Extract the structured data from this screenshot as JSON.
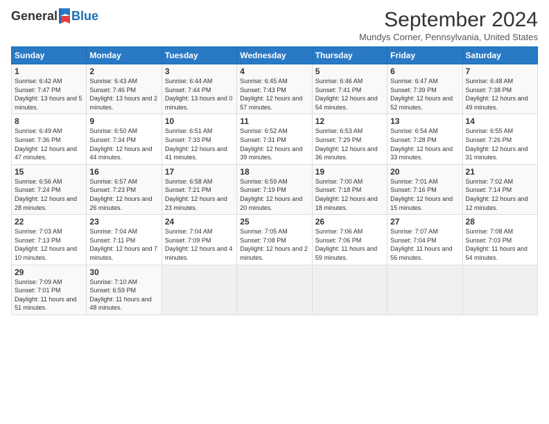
{
  "logo": {
    "general": "General",
    "blue": "Blue"
  },
  "title": "September 2024",
  "location": "Mundys Corner, Pennsylvania, United States",
  "days_of_week": [
    "Sunday",
    "Monday",
    "Tuesday",
    "Wednesday",
    "Thursday",
    "Friday",
    "Saturday"
  ],
  "weeks": [
    [
      {
        "day": "1",
        "sunrise": "6:42 AM",
        "sunset": "7:47 PM",
        "daylight": "13 hours and 5 minutes."
      },
      {
        "day": "2",
        "sunrise": "6:43 AM",
        "sunset": "7:46 PM",
        "daylight": "13 hours and 2 minutes."
      },
      {
        "day": "3",
        "sunrise": "6:44 AM",
        "sunset": "7:44 PM",
        "daylight": "13 hours and 0 minutes."
      },
      {
        "day": "4",
        "sunrise": "6:45 AM",
        "sunset": "7:43 PM",
        "daylight": "12 hours and 57 minutes."
      },
      {
        "day": "5",
        "sunrise": "6:46 AM",
        "sunset": "7:41 PM",
        "daylight": "12 hours and 54 minutes."
      },
      {
        "day": "6",
        "sunrise": "6:47 AM",
        "sunset": "7:39 PM",
        "daylight": "12 hours and 52 minutes."
      },
      {
        "day": "7",
        "sunrise": "6:48 AM",
        "sunset": "7:38 PM",
        "daylight": "12 hours and 49 minutes."
      }
    ],
    [
      {
        "day": "8",
        "sunrise": "6:49 AM",
        "sunset": "7:36 PM",
        "daylight": "12 hours and 47 minutes."
      },
      {
        "day": "9",
        "sunrise": "6:50 AM",
        "sunset": "7:34 PM",
        "daylight": "12 hours and 44 minutes."
      },
      {
        "day": "10",
        "sunrise": "6:51 AM",
        "sunset": "7:33 PM",
        "daylight": "12 hours and 41 minutes."
      },
      {
        "day": "11",
        "sunrise": "6:52 AM",
        "sunset": "7:31 PM",
        "daylight": "12 hours and 39 minutes."
      },
      {
        "day": "12",
        "sunrise": "6:53 AM",
        "sunset": "7:29 PM",
        "daylight": "12 hours and 36 minutes."
      },
      {
        "day": "13",
        "sunrise": "6:54 AM",
        "sunset": "7:28 PM",
        "daylight": "12 hours and 33 minutes."
      },
      {
        "day": "14",
        "sunrise": "6:55 AM",
        "sunset": "7:26 PM",
        "daylight": "12 hours and 31 minutes."
      }
    ],
    [
      {
        "day": "15",
        "sunrise": "6:56 AM",
        "sunset": "7:24 PM",
        "daylight": "12 hours and 28 minutes."
      },
      {
        "day": "16",
        "sunrise": "6:57 AM",
        "sunset": "7:23 PM",
        "daylight": "12 hours and 26 minutes."
      },
      {
        "day": "17",
        "sunrise": "6:58 AM",
        "sunset": "7:21 PM",
        "daylight": "12 hours and 23 minutes."
      },
      {
        "day": "18",
        "sunrise": "6:59 AM",
        "sunset": "7:19 PM",
        "daylight": "12 hours and 20 minutes."
      },
      {
        "day": "19",
        "sunrise": "7:00 AM",
        "sunset": "7:18 PM",
        "daylight": "12 hours and 18 minutes."
      },
      {
        "day": "20",
        "sunrise": "7:01 AM",
        "sunset": "7:16 PM",
        "daylight": "12 hours and 15 minutes."
      },
      {
        "day": "21",
        "sunrise": "7:02 AM",
        "sunset": "7:14 PM",
        "daylight": "12 hours and 12 minutes."
      }
    ],
    [
      {
        "day": "22",
        "sunrise": "7:03 AM",
        "sunset": "7:13 PM",
        "daylight": "12 hours and 10 minutes."
      },
      {
        "day": "23",
        "sunrise": "7:04 AM",
        "sunset": "7:11 PM",
        "daylight": "12 hours and 7 minutes."
      },
      {
        "day": "24",
        "sunrise": "7:04 AM",
        "sunset": "7:09 PM",
        "daylight": "12 hours and 4 minutes."
      },
      {
        "day": "25",
        "sunrise": "7:05 AM",
        "sunset": "7:08 PM",
        "daylight": "12 hours and 2 minutes."
      },
      {
        "day": "26",
        "sunrise": "7:06 AM",
        "sunset": "7:06 PM",
        "daylight": "11 hours and 59 minutes."
      },
      {
        "day": "27",
        "sunrise": "7:07 AM",
        "sunset": "7:04 PM",
        "daylight": "11 hours and 56 minutes."
      },
      {
        "day": "28",
        "sunrise": "7:08 AM",
        "sunset": "7:03 PM",
        "daylight": "11 hours and 54 minutes."
      }
    ],
    [
      {
        "day": "29",
        "sunrise": "7:09 AM",
        "sunset": "7:01 PM",
        "daylight": "11 hours and 51 minutes."
      },
      {
        "day": "30",
        "sunrise": "7:10 AM",
        "sunset": "6:59 PM",
        "daylight": "11 hours and 48 minutes."
      },
      null,
      null,
      null,
      null,
      null
    ]
  ]
}
